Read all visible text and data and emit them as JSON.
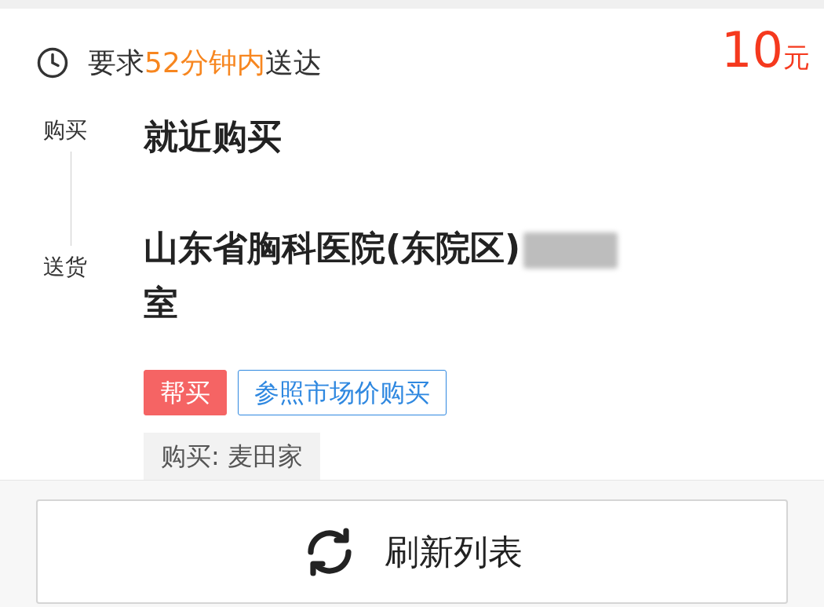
{
  "order": {
    "deadline": {
      "prefix": "要求",
      "highlight": "52分钟内",
      "suffix": "送达"
    },
    "price": {
      "amount": "10",
      "unit": "元"
    },
    "route": [
      {
        "label": "购买",
        "text": "就近购买"
      },
      {
        "label": "送货",
        "text": "山东省胸科医院(东院区)",
        "redacted": true,
        "text_after": "室"
      }
    ],
    "tags": [
      {
        "label": "帮买",
        "kind": "filled"
      },
      {
        "label": "参照市场价购买",
        "kind": "outline"
      }
    ],
    "shop": "购买: 麦田家"
  },
  "refresh_button": {
    "label": "刷新列表"
  }
}
